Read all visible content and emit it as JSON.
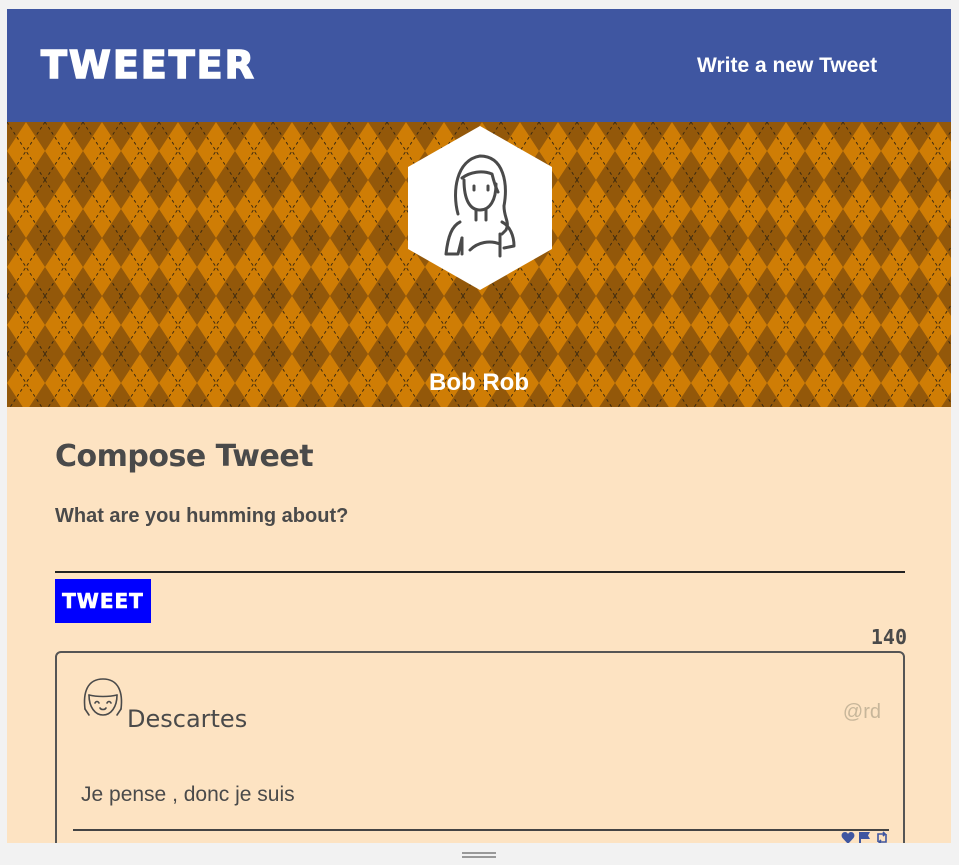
{
  "nav": {
    "logo": "TWEETER",
    "write_link": "Write a new Tweet"
  },
  "colors": {
    "nav_bg": "#3f56a1",
    "page_bg": "#fde3c2",
    "banner_light": "#c77805",
    "banner_dark": "#8a5307",
    "tweet_button": "#0000ff"
  },
  "profile": {
    "name": "Bob Rob",
    "avatar_icon": "person-outline-icon"
  },
  "compose": {
    "title": "Compose Tweet",
    "placeholder": "What are you humming about?",
    "button_label": "TWEET",
    "counter": "140"
  },
  "tweets": [
    {
      "name": "Descartes",
      "handle": "@rd",
      "text": "Je pense , donc je suis",
      "avatar_icon": "smiling-face-icon",
      "actions": [
        "heart-icon",
        "flag-icon",
        "retweet-icon"
      ]
    }
  ]
}
